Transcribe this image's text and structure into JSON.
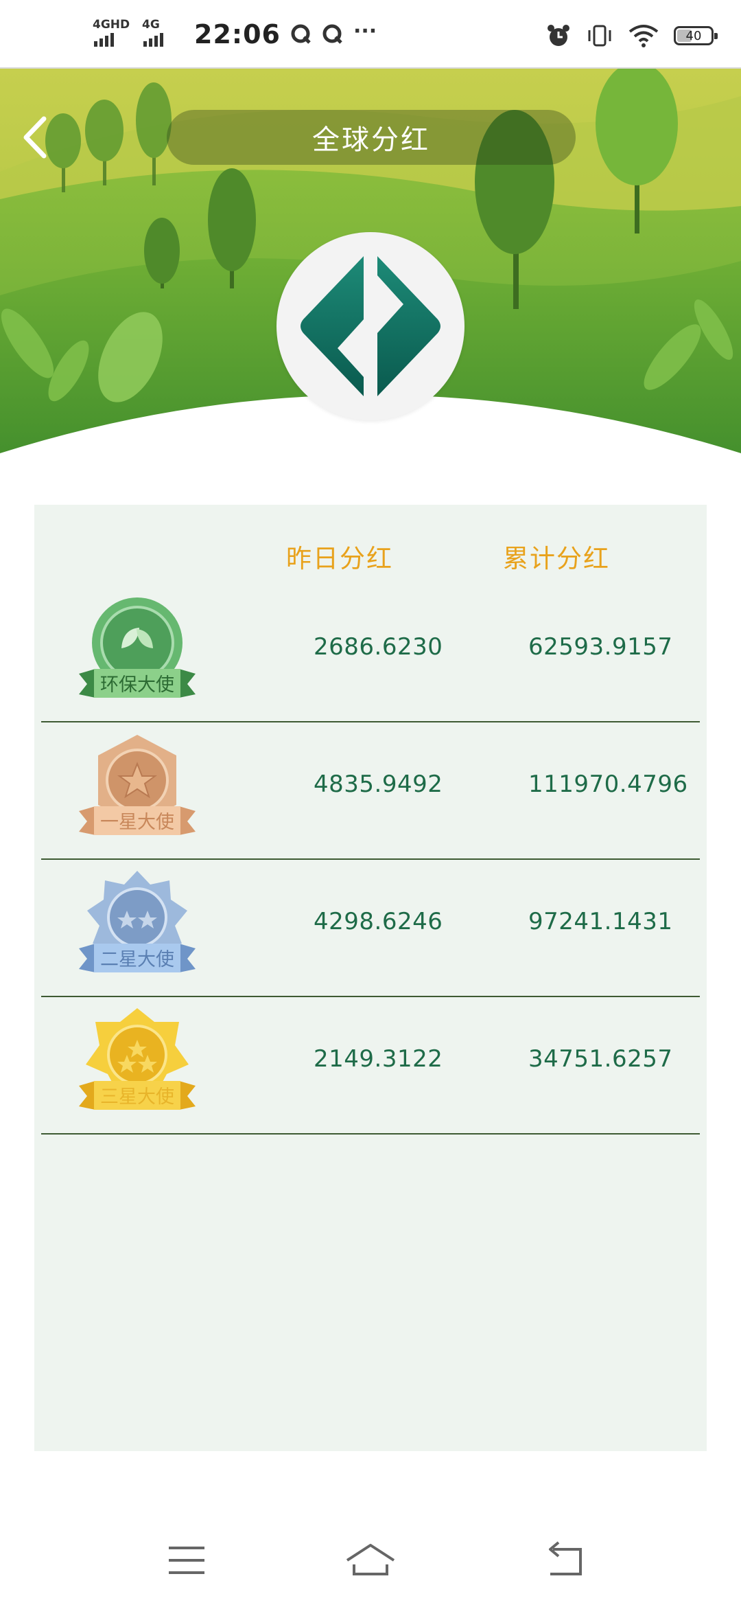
{
  "status_bar": {
    "network_1": "4GHD",
    "network_2": "4G",
    "time": "22:06",
    "more": "···",
    "battery": "40",
    "icons": [
      "q-notification-icon",
      "q-notification-icon",
      "alarm-icon",
      "vibrate-icon",
      "wifi-icon",
      "battery-icon"
    ]
  },
  "header": {
    "title": "全球分红",
    "back_icon": "chevron-left-icon",
    "logo_icon": "app-logo-icon"
  },
  "table": {
    "columns": [
      "昨日分红",
      "累计分红"
    ],
    "rows": [
      {
        "level": "环保大使",
        "yesterday": "2686.6230",
        "total": "62593.9157",
        "color": "#52a85c"
      },
      {
        "level": "一星大使",
        "yesterday": "4835.9492",
        "total": "111970.4796",
        "color": "#d9a172"
      },
      {
        "level": "二星大使",
        "yesterday": "4298.6246",
        "total": "97241.1431",
        "color": "#8fb1d9"
      },
      {
        "level": "三星大使",
        "yesterday": "2149.3122",
        "total": "34751.6257",
        "color": "#f2c230"
      }
    ]
  },
  "nav_bar": {
    "icons": [
      "menu-icon",
      "home-icon",
      "back-icon"
    ]
  },
  "colors": {
    "accent": "#e8a21c",
    "value_text": "#1e6b48",
    "panel_bg": "#eef4ef",
    "logo_teal": "#0f6a5e"
  }
}
